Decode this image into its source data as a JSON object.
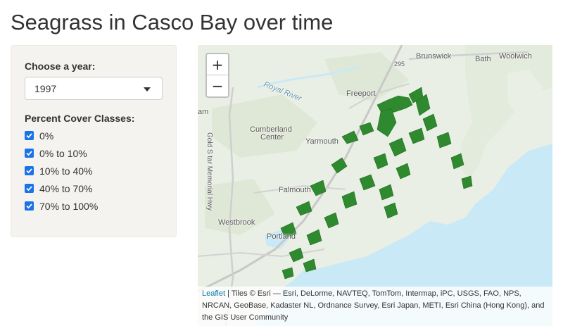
{
  "page": {
    "title": "Seagrass in Casco Bay over time"
  },
  "controls": {
    "year_label": "Choose a year:",
    "year_selected": "1997",
    "cover_label": "Percent Cover Classes:",
    "cover_classes": [
      {
        "label": "0%",
        "checked": true
      },
      {
        "label": "0% to 10%",
        "checked": true
      },
      {
        "label": "10% to 40%",
        "checked": true
      },
      {
        "label": "40% to 70%",
        "checked": true
      },
      {
        "label": "70% to 100%",
        "checked": true
      }
    ],
    "checkbox_color": "#1a73e8"
  },
  "map": {
    "zoom_in": "+",
    "zoom_out": "−",
    "places": {
      "brunswick": "Brunswick",
      "bath": "Bath",
      "woolwich": "Woolwich",
      "freeport": "Freeport",
      "royal_river": "Royal River",
      "cumberland": "Cumberland",
      "cumberland_center": "Center",
      "yarmouth": "Yarmouth",
      "falmouth": "Falmouth",
      "westbrook": "Westbrook",
      "portland": "Portland",
      "gray": "am",
      "road": "Gold S tar Memorial Hwy",
      "route_295": "295"
    },
    "attribution": {
      "link": "Leaflet",
      "text": " | Tiles © Esri — Esri, DeLorme, NAVTEQ, TomTom, Intermap, iPC, USGS, FAO, NPS, NRCAN, GeoBase, Kadaster NL, Ordnance Survey, Esri Japan, METI, Esri China (Hong Kong), and the GIS User Community"
    },
    "colors": {
      "water": "#c9e9f6",
      "land": "#e9efe4",
      "seagrass": "#2f8a2f",
      "road": "#c8c8c8"
    }
  }
}
